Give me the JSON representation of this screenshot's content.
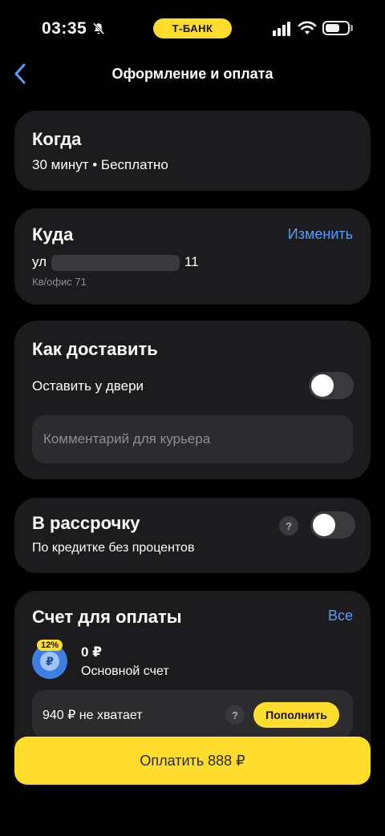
{
  "status_bar": {
    "time": "03:35",
    "bank_label": "Т-БАНК",
    "icons": [
      "bell-slash-icon",
      "signal-icon",
      "wifi-icon",
      "battery-icon"
    ]
  },
  "nav": {
    "title": "Оформление и оплата",
    "back_icon": "chevron-left-icon"
  },
  "when": {
    "title": "Когда",
    "time": "30 минут",
    "separator": "•",
    "price": "Бесплатно"
  },
  "where": {
    "title": "Куда",
    "change_label": "Изменить",
    "street_prefix": "ул",
    "house": "11",
    "apartment": "Кв/офис 71"
  },
  "delivery": {
    "title": "Как доставить",
    "leave_at_door_label": "Оставить у двери",
    "leave_at_door_on": false,
    "comment_placeholder": "Комментарий для курьера"
  },
  "installment": {
    "title": "В рассрочку",
    "subtitle": "По кредитке без процентов",
    "help": "?",
    "enabled": false
  },
  "payment_account": {
    "title": "Счет для оплаты",
    "all_label": "Все",
    "cashback_badge": "12%",
    "currency_symbol": "₽",
    "balance": "0 ₽",
    "account_name": "Основной счет",
    "shortage_text": "940 ₽ не хватает",
    "help": "?",
    "topup_label": "Пополнить"
  },
  "pay_button": {
    "label": "Оплатить 888 ₽"
  },
  "colors": {
    "accent_yellow": "#ffdd2d",
    "link_blue": "#5c9cf5",
    "card_bg": "#1c1c1e",
    "background": "#000000"
  }
}
